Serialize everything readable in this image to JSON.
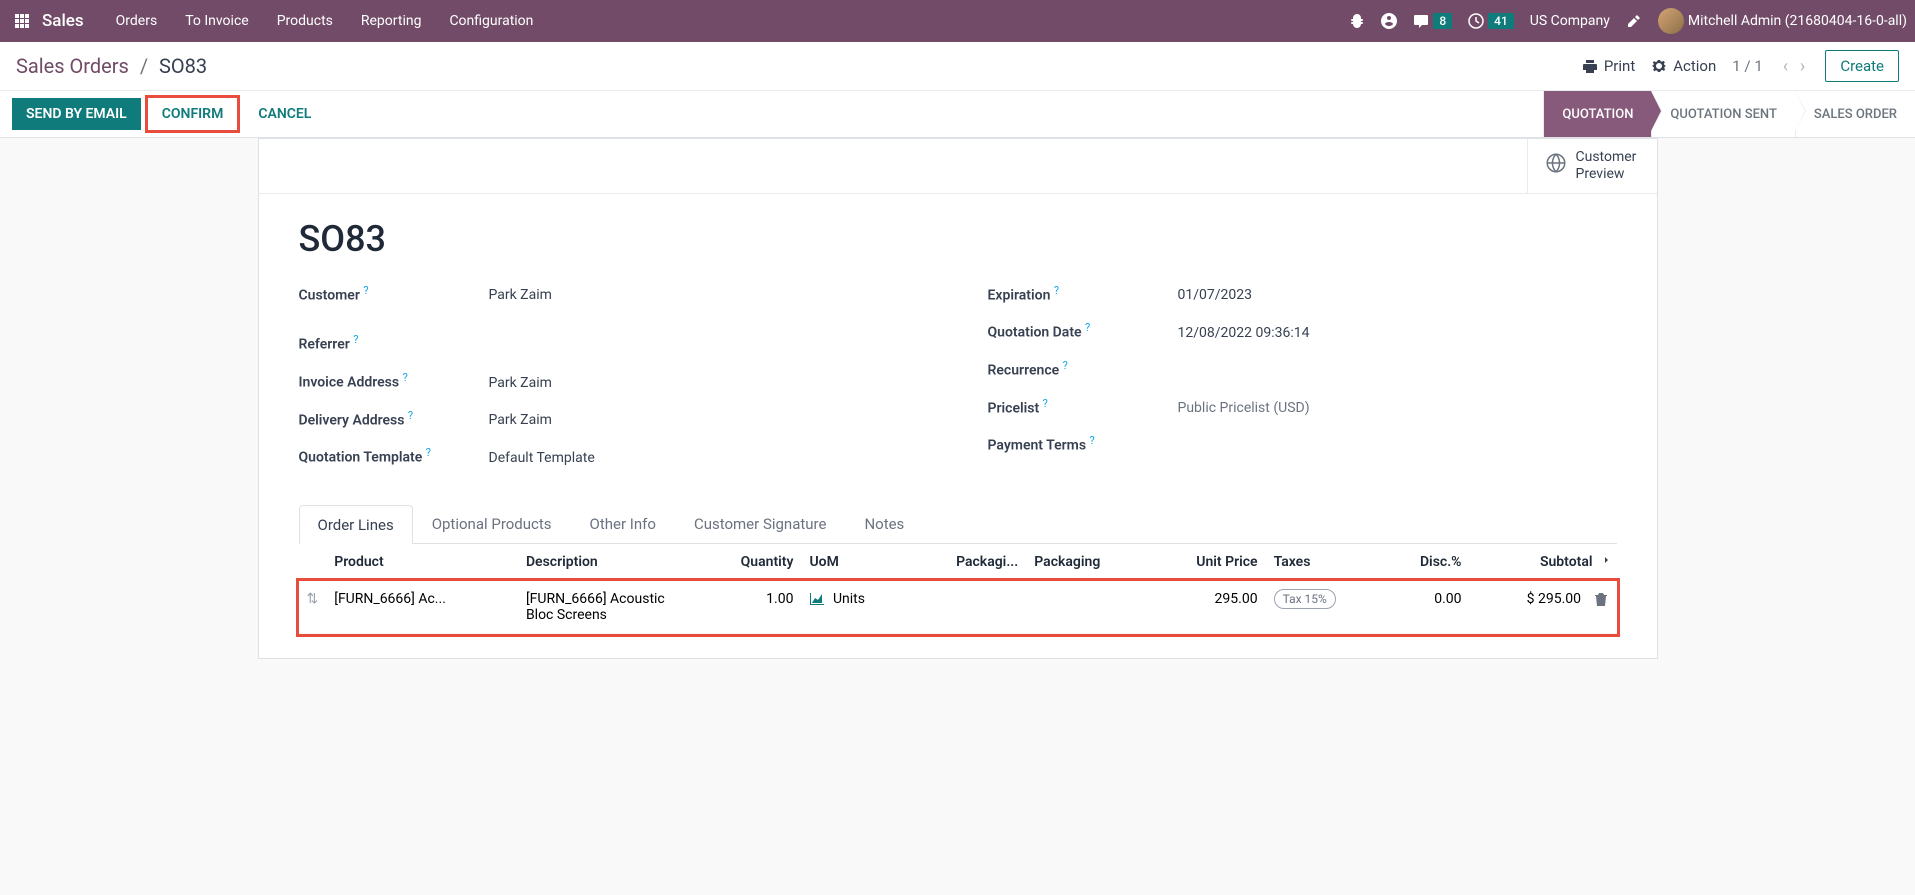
{
  "navbar": {
    "brand": "Sales",
    "links": [
      "Orders",
      "To Invoice",
      "Products",
      "Reporting",
      "Configuration"
    ],
    "msg_count": "8",
    "activity_count": "41",
    "company": "US Company",
    "user": "Mitchell Admin (21680404-16-0-all)"
  },
  "breadcrumb": {
    "root": "Sales Orders",
    "current": "SO83"
  },
  "cp": {
    "print": "Print",
    "action": "Action",
    "pager": "1 / 1",
    "create": "Create"
  },
  "buttons": {
    "send_email": "Send by Email",
    "confirm": "Confirm",
    "cancel": "Cancel"
  },
  "status": {
    "quotation": "Quotation",
    "quotation_sent": "Quotation Sent",
    "sales_order": "Sales Order"
  },
  "stat_button": {
    "label": "Customer\nPreview"
  },
  "form": {
    "title": "SO83",
    "labels": {
      "customer": "Customer",
      "referrer": "Referrer",
      "invoice_address": "Invoice Address",
      "delivery_address": "Delivery Address",
      "quotation_template": "Quotation Template",
      "expiration": "Expiration",
      "quotation_date": "Quotation Date",
      "recurrence": "Recurrence",
      "pricelist": "Pricelist",
      "payment_terms": "Payment Terms"
    },
    "values": {
      "customer": "Park Zaim",
      "referrer": "",
      "invoice_address": "Park Zaim",
      "delivery_address": "Park Zaim",
      "quotation_template": "Default Template",
      "expiration": "01/07/2023",
      "quotation_date": "12/08/2022 09:36:14",
      "recurrence": "",
      "pricelist": "Public Pricelist (USD)",
      "payment_terms": ""
    }
  },
  "tabs": {
    "order_lines": "Order Lines",
    "optional_products": "Optional Products",
    "other_info": "Other Info",
    "customer_signature": "Customer Signature",
    "notes": "Notes"
  },
  "table": {
    "headers": {
      "product": "Product",
      "description": "Description",
      "quantity": "Quantity",
      "uom": "UoM",
      "packaging1": "Packagi...",
      "packaging2": "Packaging",
      "unit_price": "Unit Price",
      "taxes": "Taxes",
      "disc": "Disc.%",
      "subtotal": "Subtotal"
    },
    "row": {
      "product": "[FURN_6666] Ac...",
      "description": "[FURN_6666] Acoustic Bloc Screens",
      "quantity": "1.00",
      "uom": "Units",
      "unit_price": "295.00",
      "tax": "Tax 15%",
      "disc": "0.00",
      "subtotal": "$ 295.00"
    }
  }
}
